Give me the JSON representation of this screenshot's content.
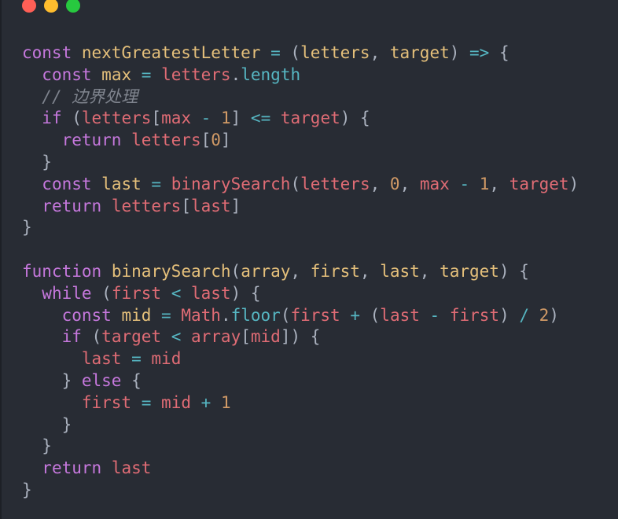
{
  "window": {
    "traffic_lights": {
      "close": "#ff5f56",
      "minimize": "#ffbd2e",
      "zoom": "#27c93f"
    }
  },
  "code": {
    "language": "javascript",
    "lines": [
      [
        {
          "t": "k",
          "s": "const"
        },
        {
          "t": "p",
          "s": " "
        },
        {
          "t": "f",
          "s": "nextGreatestLetter"
        },
        {
          "t": "p",
          "s": " "
        },
        {
          "t": "o",
          "s": "="
        },
        {
          "t": "p",
          "s": " ("
        },
        {
          "t": "f",
          "s": "letters"
        },
        {
          "t": "p",
          "s": ", "
        },
        {
          "t": "f",
          "s": "target"
        },
        {
          "t": "p",
          "s": ") "
        },
        {
          "t": "o",
          "s": "=>"
        },
        {
          "t": "p",
          "s": " {"
        }
      ],
      [
        {
          "t": "p",
          "s": "  "
        },
        {
          "t": "k",
          "s": "const"
        },
        {
          "t": "p",
          "s": " "
        },
        {
          "t": "f",
          "s": "max"
        },
        {
          "t": "p",
          "s": " "
        },
        {
          "t": "o",
          "s": "="
        },
        {
          "t": "p",
          "s": " "
        },
        {
          "t": "v",
          "s": "letters"
        },
        {
          "t": "p",
          "s": "."
        },
        {
          "t": "o",
          "s": "length"
        }
      ],
      [
        {
          "t": "p",
          "s": "  "
        },
        {
          "t": "c",
          "s": "// 边界处理"
        }
      ],
      [
        {
          "t": "p",
          "s": "  "
        },
        {
          "t": "k",
          "s": "if"
        },
        {
          "t": "p",
          "s": " ("
        },
        {
          "t": "v",
          "s": "letters"
        },
        {
          "t": "p",
          "s": "["
        },
        {
          "t": "v",
          "s": "max"
        },
        {
          "t": "p",
          "s": " "
        },
        {
          "t": "o",
          "s": "-"
        },
        {
          "t": "p",
          "s": " "
        },
        {
          "t": "n",
          "s": "1"
        },
        {
          "t": "p",
          "s": "] "
        },
        {
          "t": "o",
          "s": "<="
        },
        {
          "t": "p",
          "s": " "
        },
        {
          "t": "v",
          "s": "target"
        },
        {
          "t": "p",
          "s": ") {"
        }
      ],
      [
        {
          "t": "p",
          "s": "    "
        },
        {
          "t": "k",
          "s": "return"
        },
        {
          "t": "p",
          "s": " "
        },
        {
          "t": "v",
          "s": "letters"
        },
        {
          "t": "p",
          "s": "["
        },
        {
          "t": "n",
          "s": "0"
        },
        {
          "t": "p",
          "s": "]"
        }
      ],
      [
        {
          "t": "p",
          "s": "  }"
        }
      ],
      [
        {
          "t": "p",
          "s": "  "
        },
        {
          "t": "k",
          "s": "const"
        },
        {
          "t": "p",
          "s": " "
        },
        {
          "t": "f",
          "s": "last"
        },
        {
          "t": "p",
          "s": " "
        },
        {
          "t": "o",
          "s": "="
        },
        {
          "t": "p",
          "s": " "
        },
        {
          "t": "v",
          "s": "binarySearch"
        },
        {
          "t": "p",
          "s": "("
        },
        {
          "t": "v",
          "s": "letters"
        },
        {
          "t": "p",
          "s": ", "
        },
        {
          "t": "n",
          "s": "0"
        },
        {
          "t": "p",
          "s": ", "
        },
        {
          "t": "v",
          "s": "max"
        },
        {
          "t": "p",
          "s": " "
        },
        {
          "t": "o",
          "s": "-"
        },
        {
          "t": "p",
          "s": " "
        },
        {
          "t": "n",
          "s": "1"
        },
        {
          "t": "p",
          "s": ", "
        },
        {
          "t": "v",
          "s": "target"
        },
        {
          "t": "p",
          "s": ")"
        }
      ],
      [
        {
          "t": "p",
          "s": "  "
        },
        {
          "t": "k",
          "s": "return"
        },
        {
          "t": "p",
          "s": " "
        },
        {
          "t": "v",
          "s": "letters"
        },
        {
          "t": "p",
          "s": "["
        },
        {
          "t": "v",
          "s": "last"
        },
        {
          "t": "p",
          "s": "]"
        }
      ],
      [
        {
          "t": "p",
          "s": "}"
        }
      ],
      [
        {
          "t": "p",
          "s": ""
        }
      ],
      [
        {
          "t": "k",
          "s": "function"
        },
        {
          "t": "p",
          "s": " "
        },
        {
          "t": "f",
          "s": "binarySearch"
        },
        {
          "t": "p",
          "s": "("
        },
        {
          "t": "f",
          "s": "array"
        },
        {
          "t": "p",
          "s": ", "
        },
        {
          "t": "f",
          "s": "first"
        },
        {
          "t": "p",
          "s": ", "
        },
        {
          "t": "f",
          "s": "last"
        },
        {
          "t": "p",
          "s": ", "
        },
        {
          "t": "f",
          "s": "target"
        },
        {
          "t": "p",
          "s": ") {"
        }
      ],
      [
        {
          "t": "p",
          "s": "  "
        },
        {
          "t": "k",
          "s": "while"
        },
        {
          "t": "p",
          "s": " ("
        },
        {
          "t": "v",
          "s": "first"
        },
        {
          "t": "p",
          "s": " "
        },
        {
          "t": "o",
          "s": "<"
        },
        {
          "t": "p",
          "s": " "
        },
        {
          "t": "v",
          "s": "last"
        },
        {
          "t": "p",
          "s": ") {"
        }
      ],
      [
        {
          "t": "p",
          "s": "    "
        },
        {
          "t": "k",
          "s": "const"
        },
        {
          "t": "p",
          "s": " "
        },
        {
          "t": "f",
          "s": "mid"
        },
        {
          "t": "p",
          "s": " "
        },
        {
          "t": "o",
          "s": "="
        },
        {
          "t": "p",
          "s": " "
        },
        {
          "t": "v",
          "s": "Math"
        },
        {
          "t": "p",
          "s": "."
        },
        {
          "t": "o",
          "s": "floor"
        },
        {
          "t": "p",
          "s": "("
        },
        {
          "t": "v",
          "s": "first"
        },
        {
          "t": "p",
          "s": " "
        },
        {
          "t": "o",
          "s": "+"
        },
        {
          "t": "p",
          "s": " ("
        },
        {
          "t": "v",
          "s": "last"
        },
        {
          "t": "p",
          "s": " "
        },
        {
          "t": "o",
          "s": "-"
        },
        {
          "t": "p",
          "s": " "
        },
        {
          "t": "v",
          "s": "first"
        },
        {
          "t": "p",
          "s": ") "
        },
        {
          "t": "o",
          "s": "/"
        },
        {
          "t": "p",
          "s": " "
        },
        {
          "t": "n",
          "s": "2"
        },
        {
          "t": "p",
          "s": ")"
        }
      ],
      [
        {
          "t": "p",
          "s": "    "
        },
        {
          "t": "k",
          "s": "if"
        },
        {
          "t": "p",
          "s": " ("
        },
        {
          "t": "v",
          "s": "target"
        },
        {
          "t": "p",
          "s": " "
        },
        {
          "t": "o",
          "s": "<"
        },
        {
          "t": "p",
          "s": " "
        },
        {
          "t": "v",
          "s": "array"
        },
        {
          "t": "p",
          "s": "["
        },
        {
          "t": "v",
          "s": "mid"
        },
        {
          "t": "p",
          "s": "]) {"
        }
      ],
      [
        {
          "t": "p",
          "s": "      "
        },
        {
          "t": "v",
          "s": "last"
        },
        {
          "t": "p",
          "s": " "
        },
        {
          "t": "o",
          "s": "="
        },
        {
          "t": "p",
          "s": " "
        },
        {
          "t": "v",
          "s": "mid"
        }
      ],
      [
        {
          "t": "p",
          "s": "    } "
        },
        {
          "t": "k",
          "s": "else"
        },
        {
          "t": "p",
          "s": " {"
        }
      ],
      [
        {
          "t": "p",
          "s": "      "
        },
        {
          "t": "v",
          "s": "first"
        },
        {
          "t": "p",
          "s": " "
        },
        {
          "t": "o",
          "s": "="
        },
        {
          "t": "p",
          "s": " "
        },
        {
          "t": "v",
          "s": "mid"
        },
        {
          "t": "p",
          "s": " "
        },
        {
          "t": "o",
          "s": "+"
        },
        {
          "t": "p",
          "s": " "
        },
        {
          "t": "n",
          "s": "1"
        }
      ],
      [
        {
          "t": "p",
          "s": "    }"
        }
      ],
      [
        {
          "t": "p",
          "s": "  }"
        }
      ],
      [
        {
          "t": "p",
          "s": "  "
        },
        {
          "t": "k",
          "s": "return"
        },
        {
          "t": "p",
          "s": " "
        },
        {
          "t": "v",
          "s": "last"
        }
      ],
      [
        {
          "t": "p",
          "s": "}"
        }
      ]
    ]
  }
}
